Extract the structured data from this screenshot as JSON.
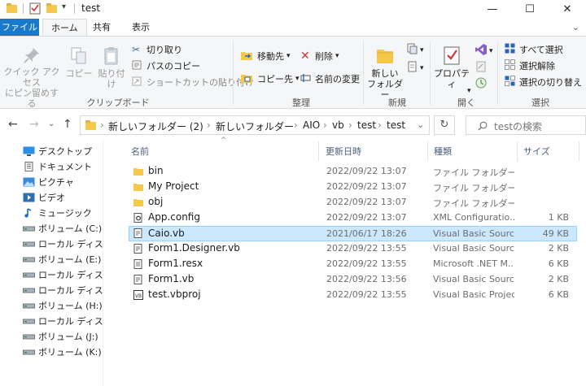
{
  "window": {
    "title": "test",
    "minimize_glyph": "—",
    "maximize_glyph": "☐",
    "close_glyph": "✕"
  },
  "ribbon_tabs": [
    "ファイル",
    "ホーム",
    "共有",
    "表示"
  ],
  "ribbon": {
    "clipboard": {
      "pin_label_1": "クイック アクセス",
      "pin_label_2": "にピン留めする",
      "copy": "コピー",
      "paste": "貼り付け",
      "cut": "切り取り",
      "copy_path": "パスのコピー",
      "paste_shortcut": "ショートカットの貼り付け",
      "group": "クリップボード"
    },
    "organize": {
      "move_to": "移動先",
      "copy_to": "コピー先",
      "delete": "削除",
      "rename": "名前の変更",
      "group": "整理"
    },
    "new": {
      "new_folder_1": "新しい",
      "new_folder_2": "フォルダー",
      "group": "新規"
    },
    "open": {
      "properties": "プロパティ",
      "group": "開く"
    },
    "select": {
      "select_all": "すべて選択",
      "select_none": "選択解除",
      "invert": "選択の切り替え",
      "group": "選択"
    }
  },
  "address": {
    "segments": [
      "新しいフォルダー (2)",
      "新しいフォルダー",
      "AIO",
      "vb",
      "test",
      "test"
    ],
    "chevron": "›",
    "search_placeholder": "testの検索"
  },
  "nav_pane": [
    {
      "label": "デスクトップ",
      "icon": "desktop-icon"
    },
    {
      "label": "ドキュメント",
      "icon": "documents-icon"
    },
    {
      "label": "ピクチャ",
      "icon": "pictures-icon"
    },
    {
      "label": "ビデオ",
      "icon": "videos-icon"
    },
    {
      "label": "ミュージック",
      "icon": "music-icon"
    },
    {
      "label": "ボリューム (C:)",
      "icon": "drive-icon"
    },
    {
      "label": "ローカル ディスク (D",
      "icon": "drive-icon"
    },
    {
      "label": "ボリューム (E:)",
      "icon": "drive-icon"
    },
    {
      "label": "ローカル ディスク (F",
      "icon": "drive-icon"
    },
    {
      "label": "ローカル ディスク (G",
      "icon": "drive-icon"
    },
    {
      "label": "ボリューム (H:)",
      "icon": "drive-icon"
    },
    {
      "label": "ローカル ディスク (I:",
      "icon": "drive-icon"
    },
    {
      "label": "ボリューム (J:)",
      "icon": "drive-icon"
    },
    {
      "label": "ボリューム (K:)",
      "icon": "drive-icon"
    }
  ],
  "columns": {
    "name": "名前",
    "date": "更新日時",
    "type": "種類",
    "size": "サイズ"
  },
  "files": [
    {
      "name": "bin",
      "date": "2022/09/22 13:07",
      "type": "ファイル フォルダー",
      "size": "",
      "icon": "folder-icon",
      "selected": false
    },
    {
      "name": "My Project",
      "date": "2022/09/22 13:07",
      "type": "ファイル フォルダー",
      "size": "",
      "icon": "folder-icon",
      "selected": false
    },
    {
      "name": "obj",
      "date": "2022/09/22 13:07",
      "type": "ファイル フォルダー",
      "size": "",
      "icon": "folder-icon",
      "selected": false
    },
    {
      "name": "App.config",
      "date": "2022/09/22 13:07",
      "type": "XML Configuratio...",
      "size": "1 KB",
      "icon": "config-file-icon",
      "selected": false
    },
    {
      "name": "Caio.vb",
      "date": "2021/06/17 18:26",
      "type": "Visual Basic Sourc...",
      "size": "49 KB",
      "icon": "vb-file-icon",
      "selected": true
    },
    {
      "name": "Form1.Designer.vb",
      "date": "2022/09/22 13:55",
      "type": "Visual Basic Sourc...",
      "size": "2 KB",
      "icon": "vb-file-icon",
      "selected": false
    },
    {
      "name": "Form1.resx",
      "date": "2022/09/22 13:55",
      "type": "Microsoft .NET M...",
      "size": "6 KB",
      "icon": "resx-file-icon",
      "selected": false
    },
    {
      "name": "Form1.vb",
      "date": "2022/09/22 13:56",
      "type": "Visual Basic Sourc...",
      "size": "2 KB",
      "icon": "vb-file-icon",
      "selected": false
    },
    {
      "name": "test.vbproj",
      "date": "2022/09/22 13:55",
      "type": "Visual Basic Project...",
      "size": "6 KB",
      "icon": "vbproj-file-icon",
      "selected": false
    }
  ],
  "colors": {
    "accent": "#1979ca",
    "selection": "#cce8ff",
    "folder": "#f3c84b"
  }
}
